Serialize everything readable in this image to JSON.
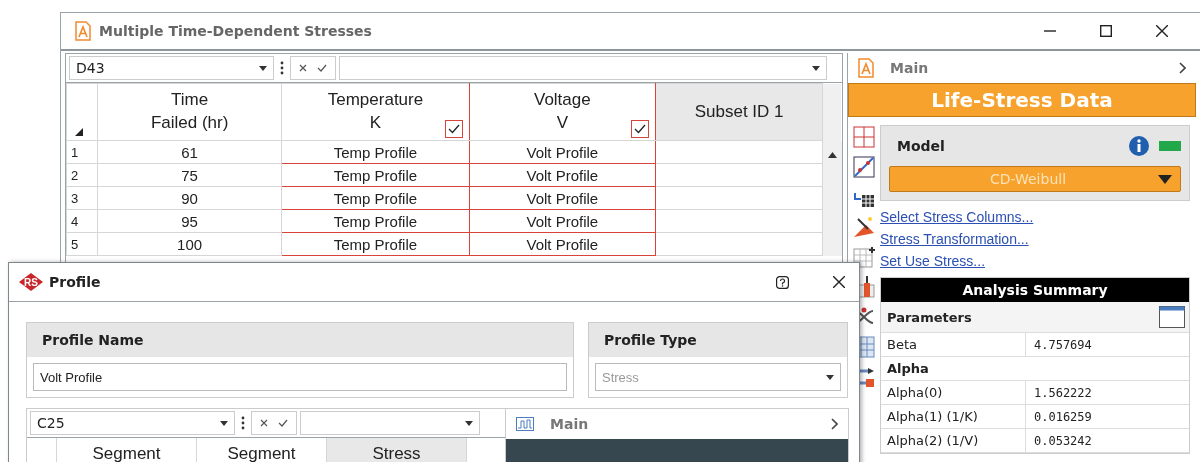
{
  "main_window": {
    "title": "Multiple Time-Dependent Stresses",
    "formula_bar": {
      "cell_ref": "D43"
    },
    "table": {
      "columns": [
        {
          "kind": "plain",
          "label": "Time\nFailed (hr)"
        },
        {
          "kind": "stress",
          "label": "Temperature\nK",
          "checked": true
        },
        {
          "kind": "stress",
          "label": "Voltage\nV",
          "checked": true
        },
        {
          "kind": "subset",
          "label": "Subset ID 1"
        }
      ],
      "rows": [
        {
          "num": "1",
          "cells": [
            "61",
            "Temp Profile",
            "Volt Profile"
          ]
        },
        {
          "num": "2",
          "cells": [
            "75",
            "Temp Profile",
            "Volt Profile"
          ]
        },
        {
          "num": "3",
          "cells": [
            "90",
            "Temp Profile",
            "Volt Profile"
          ]
        },
        {
          "num": "4",
          "cells": [
            "95",
            "Temp Profile",
            "Volt Profile"
          ]
        },
        {
          "num": "5",
          "cells": [
            "100",
            "Temp Profile",
            "Volt Profile"
          ]
        }
      ]
    },
    "side_panel": {
      "header": "Main",
      "banner": "Life-Stress Data",
      "model": {
        "label": "Model",
        "value": "CD-Weibull"
      },
      "links": [
        "Select Stress Columns...",
        "Stress Transformation...",
        "Set Use Stress..."
      ],
      "summary": {
        "title": "Analysis Summary",
        "rows": [
          {
            "kind": "header",
            "label": "Parameters"
          },
          {
            "kind": "value",
            "label": "Beta",
            "value": "4.757694"
          },
          {
            "kind": "section",
            "label": "Alpha"
          },
          {
            "kind": "value",
            "label": "Alpha(0)",
            "value": "1.562222"
          },
          {
            "kind": "value",
            "label": "Alpha(1) (1/K)",
            "value": "0.016259"
          },
          {
            "kind": "value",
            "label": "Alpha(2) (1/V)",
            "value": "0.053242"
          }
        ]
      }
    }
  },
  "dialog": {
    "logo": "RS",
    "title": "Profile",
    "name_group": {
      "label": "Profile Name",
      "value": "Volt Profile"
    },
    "type_group": {
      "label": "Profile Type",
      "value": "Stress",
      "disabled": true
    },
    "formula_bar": {
      "cell_ref": "C25"
    },
    "columns": [
      {
        "label": "Segment",
        "selected": false
      },
      {
        "label": "Segment",
        "selected": false
      },
      {
        "label": "Stress",
        "selected": true
      }
    ],
    "side_header": "Main"
  }
}
